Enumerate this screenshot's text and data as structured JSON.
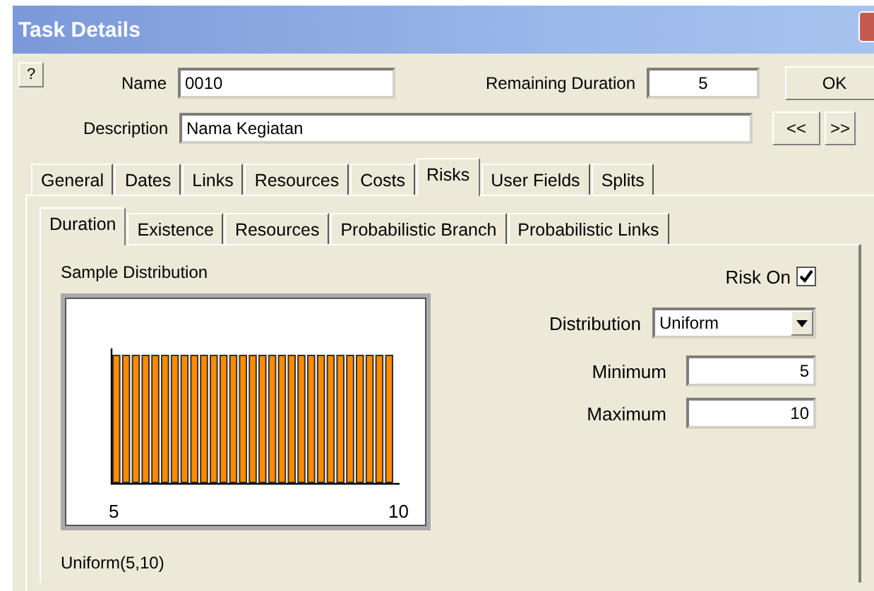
{
  "window": {
    "title": "Task Details"
  },
  "help_button": "?",
  "name": {
    "label": "Name",
    "value": "0010"
  },
  "remaining_duration": {
    "label": "Remaining Duration",
    "value": "5"
  },
  "description": {
    "label": "Description",
    "value": "Nama Kegiatan"
  },
  "buttons": {
    "ok": "OK",
    "previous": "<<",
    "next": ">>"
  },
  "tabs": [
    {
      "label": "General",
      "selected": false
    },
    {
      "label": "Dates",
      "selected": false
    },
    {
      "label": "Links",
      "selected": false
    },
    {
      "label": "Resources",
      "selected": false
    },
    {
      "label": "Costs",
      "selected": false
    },
    {
      "label": "Risks",
      "selected": true
    },
    {
      "label": "User Fields",
      "selected": false
    },
    {
      "label": "Splits",
      "selected": false
    }
  ],
  "subtabs": [
    {
      "label": "Duration",
      "selected": true
    },
    {
      "label": "Existence",
      "selected": false
    },
    {
      "label": "Resources",
      "selected": false
    },
    {
      "label": "Probabilistic Branch",
      "selected": false
    },
    {
      "label": "Probabilistic Links",
      "selected": false
    }
  ],
  "risk": {
    "sample_label": "Sample Distribution",
    "axis_min": "5",
    "axis_max": "10",
    "formula": "Uniform(5,10)",
    "risk_on": {
      "label": "Risk On",
      "checked": true
    },
    "distribution": {
      "label": "Distribution",
      "value": "Uniform"
    },
    "minimum": {
      "label": "Minimum",
      "value": "5"
    },
    "maximum": {
      "label": "Maximum",
      "value": "10"
    }
  }
}
